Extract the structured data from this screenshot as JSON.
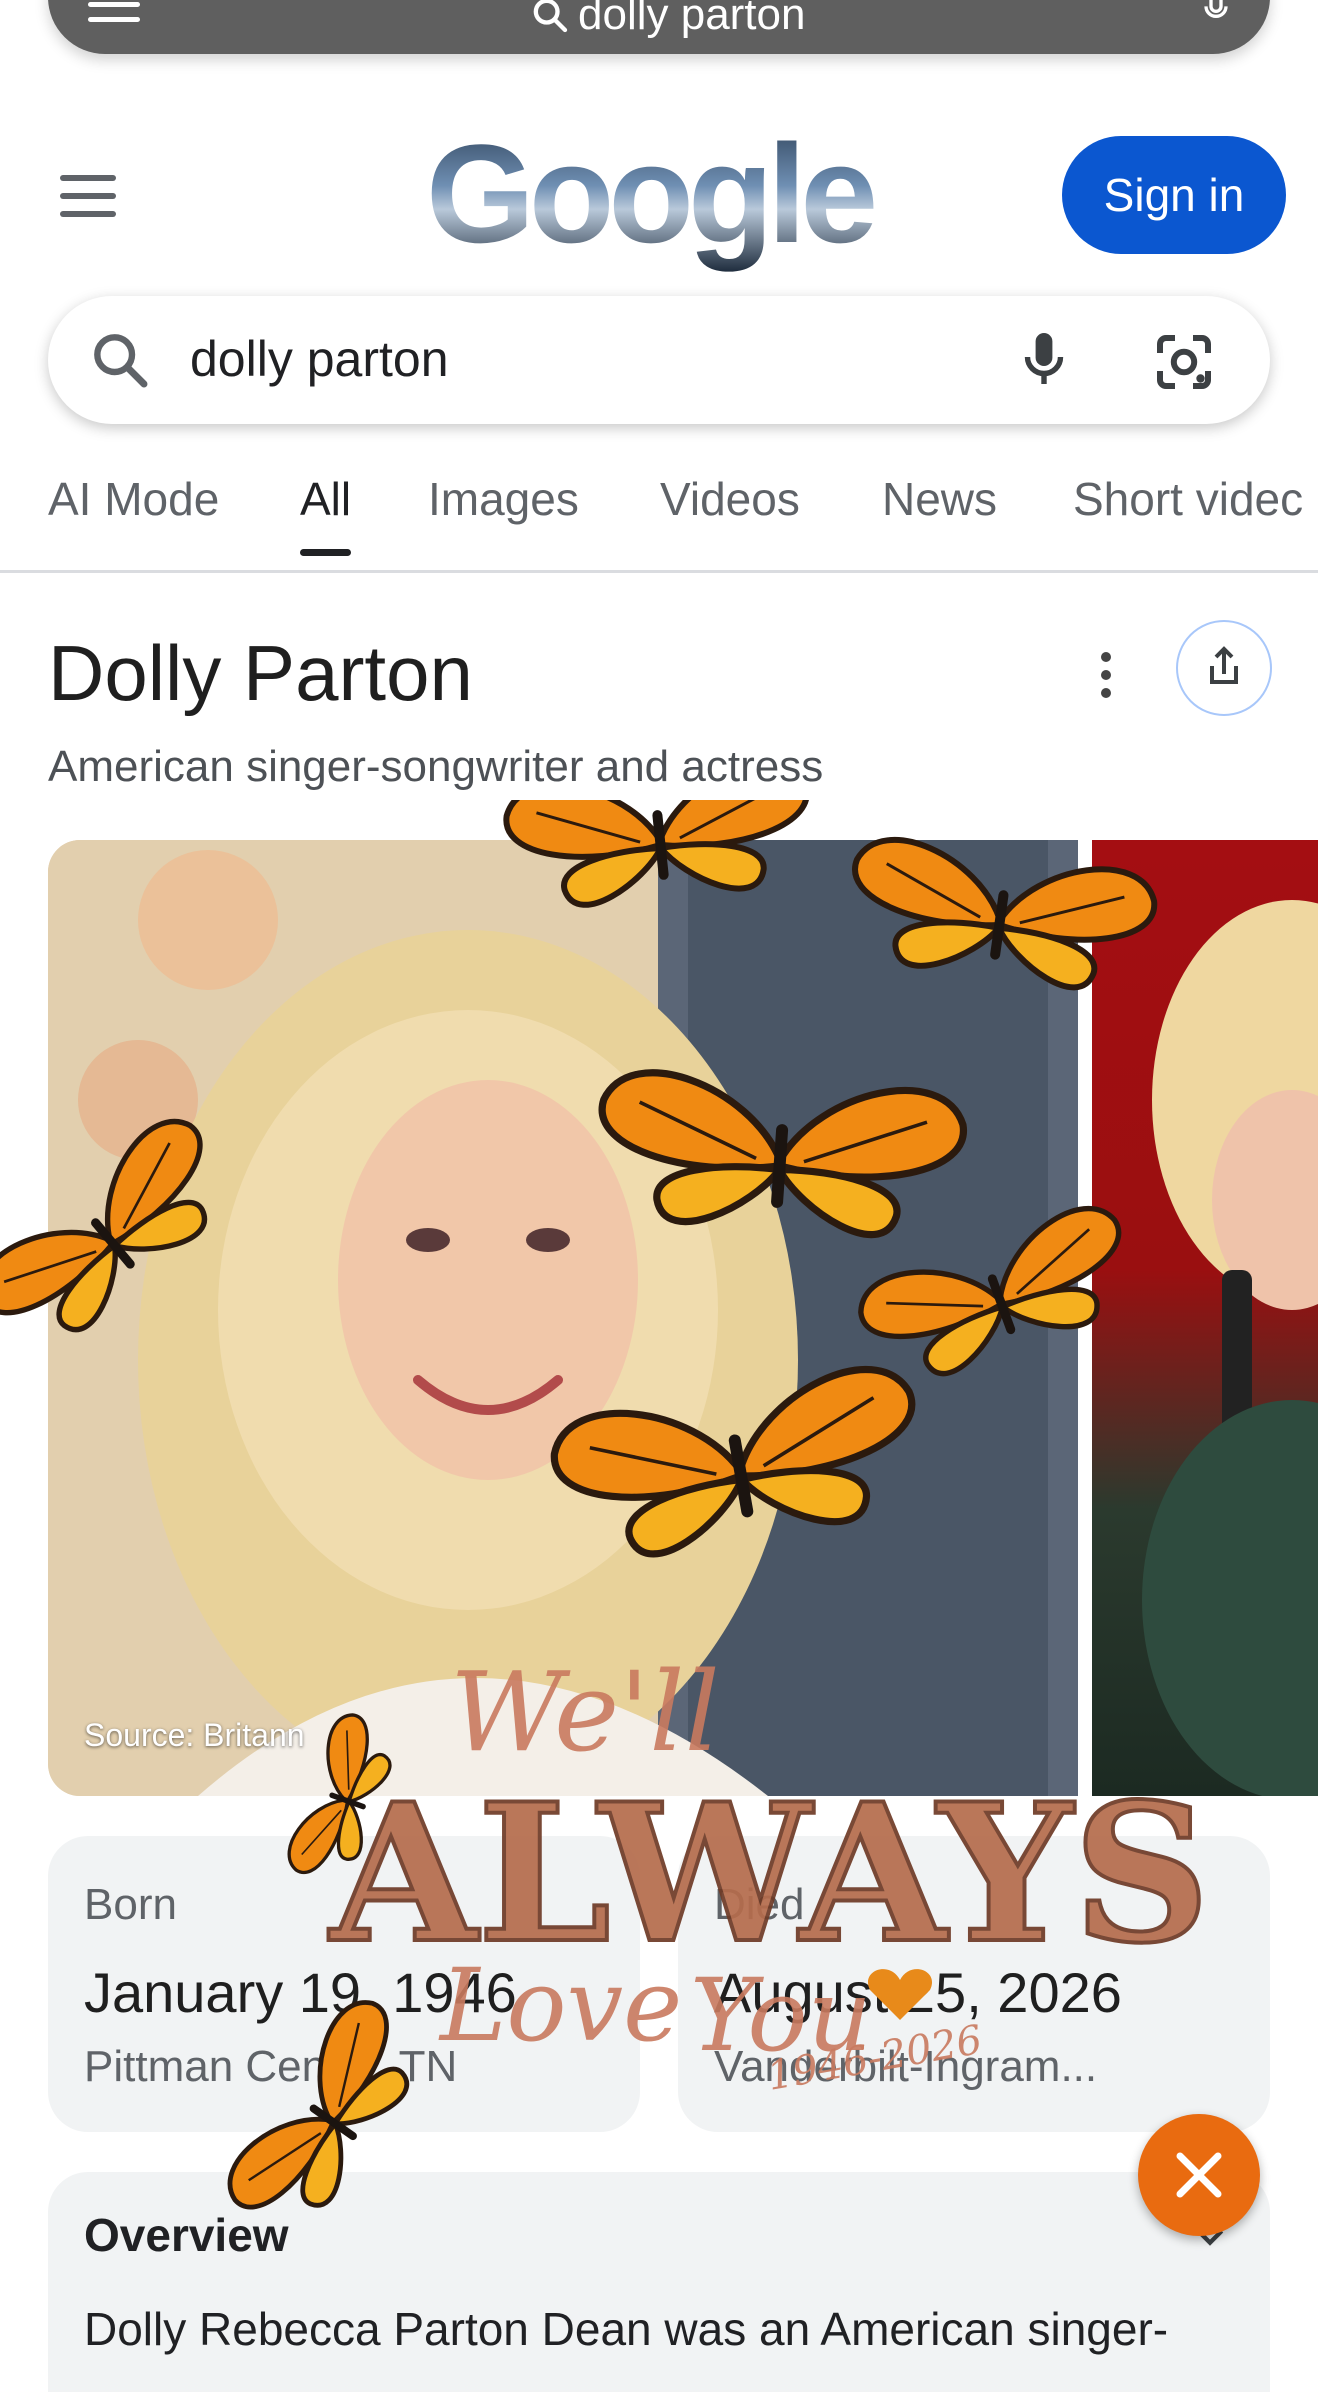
{
  "top_bar": {
    "query": "dolly parton",
    "icons": [
      "menu-icon",
      "search-icon",
      "mic-icon"
    ]
  },
  "header": {
    "logo_text": "Google",
    "sign_in_label": "Sign in",
    "menu_icon": "hamburger-icon"
  },
  "search": {
    "query": "dolly parton",
    "icons": [
      "search-icon",
      "mic-icon",
      "lens-icon"
    ]
  },
  "tabs": [
    {
      "label": "AI Mode"
    },
    {
      "label": "All",
      "active": true
    },
    {
      "label": "Images"
    },
    {
      "label": "Videos"
    },
    {
      "label": "News"
    },
    {
      "label": "Short videc"
    }
  ],
  "knowledge_panel": {
    "title": "Dolly Parton",
    "subtitle": "American singer-songwriter and actress",
    "image_source": "Source: Britann",
    "born": {
      "label": "Born",
      "date": "January 19, 1946",
      "place": "Pittman Center, TN"
    },
    "died": {
      "label": "Died",
      "date": "August 25, 2026",
      "place": "Vanderbilt-Ingram..."
    },
    "overview": {
      "heading": "Overview",
      "text": "Dolly Rebecca Parton Dean was an American singer-"
    }
  },
  "sticker": {
    "line1": "We'll",
    "line2": "ALWAYS",
    "line3": "Love",
    "line4": "You",
    "years": "1946-2026"
  },
  "colors": {
    "accent": "#0b57d0",
    "fab": "#e96b10",
    "card": "#f1f3f4",
    "monarch": "#f08a12"
  }
}
